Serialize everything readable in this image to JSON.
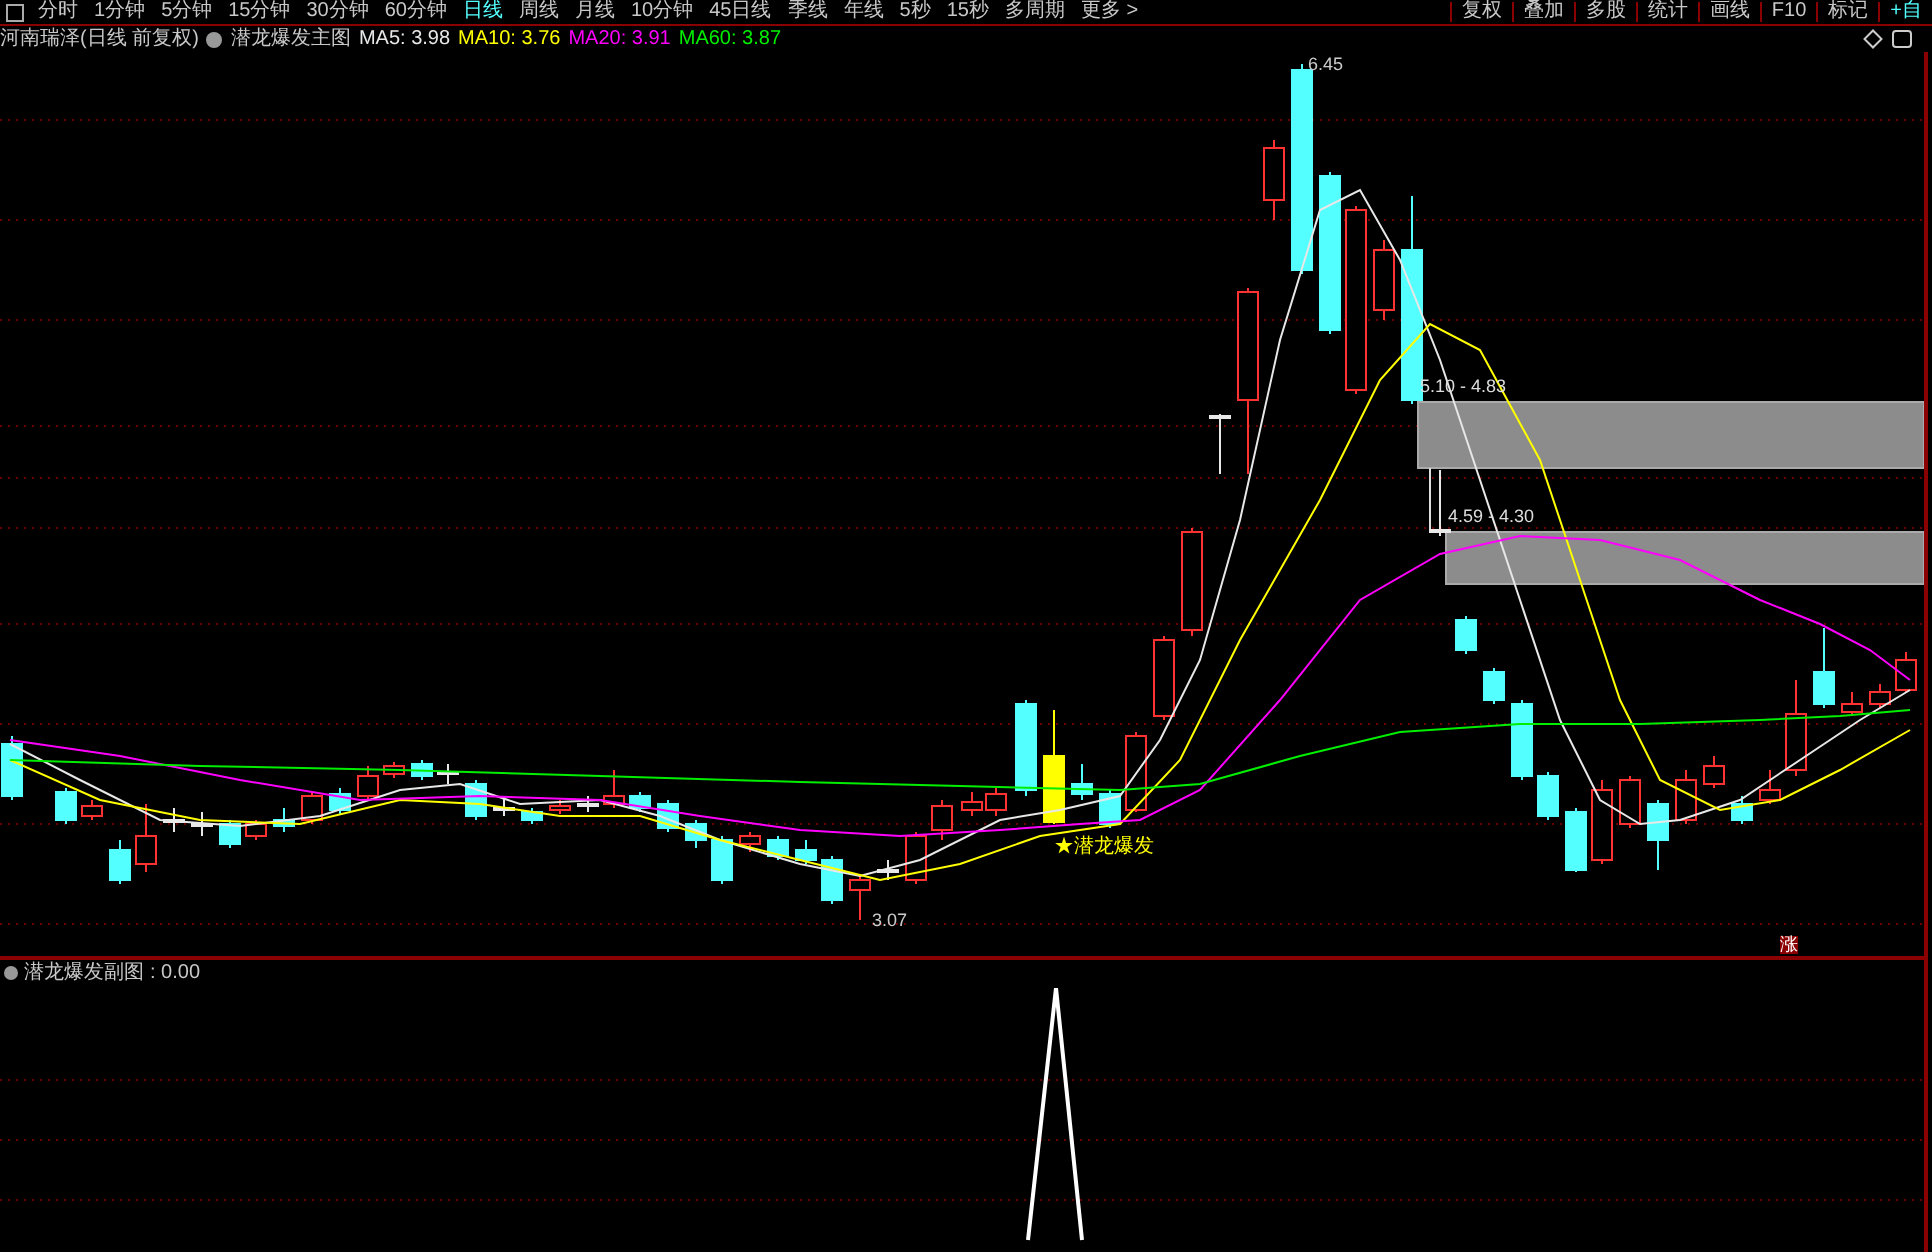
{
  "toolbar": {
    "periods": [
      {
        "label": "分时",
        "selected": false
      },
      {
        "label": "1分钟",
        "selected": false
      },
      {
        "label": "5分钟",
        "selected": false
      },
      {
        "label": "15分钟",
        "selected": false
      },
      {
        "label": "30分钟",
        "selected": false
      },
      {
        "label": "60分钟",
        "selected": false
      },
      {
        "label": "日线",
        "selected": true
      },
      {
        "label": "周线",
        "selected": false
      },
      {
        "label": "月线",
        "selected": false
      },
      {
        "label": "10分钟",
        "selected": false
      },
      {
        "label": "45日线",
        "selected": false
      },
      {
        "label": "季线",
        "selected": false
      },
      {
        "label": "年线",
        "selected": false
      },
      {
        "label": "5秒",
        "selected": false
      },
      {
        "label": "15秒",
        "selected": false
      },
      {
        "label": "多周期",
        "selected": false
      },
      {
        "label": "更多 >",
        "selected": false
      }
    ],
    "buttons": [
      "复权",
      "叠加",
      "多股",
      "统计",
      "画线",
      "F10",
      "标记",
      "+自"
    ]
  },
  "main_chart": {
    "stock": "河南瑞泽(日线 前复权)",
    "indicator": "潜龙爆发主图",
    "moving_averages": [
      {
        "label": "MA5: 3.98",
        "color": "#e8e8e8"
      },
      {
        "label": "MA10: 3.76",
        "color": "#ffff00"
      },
      {
        "label": "MA20: 3.91",
        "color": "#ff00ff"
      },
      {
        "label": "MA60: 3.87",
        "color": "#00ee00"
      }
    ],
    "high_label": "6.45",
    "low_label": "3.07",
    "zones": [
      {
        "label": "5.10 - 4.83"
      },
      {
        "label": "4.59 - 4.30"
      }
    ],
    "signal_label": "★潜龙爆发",
    "marker": "涨"
  },
  "sub_chart": {
    "indicator": "潜龙爆发副图",
    "value": ": 0.00"
  }
}
